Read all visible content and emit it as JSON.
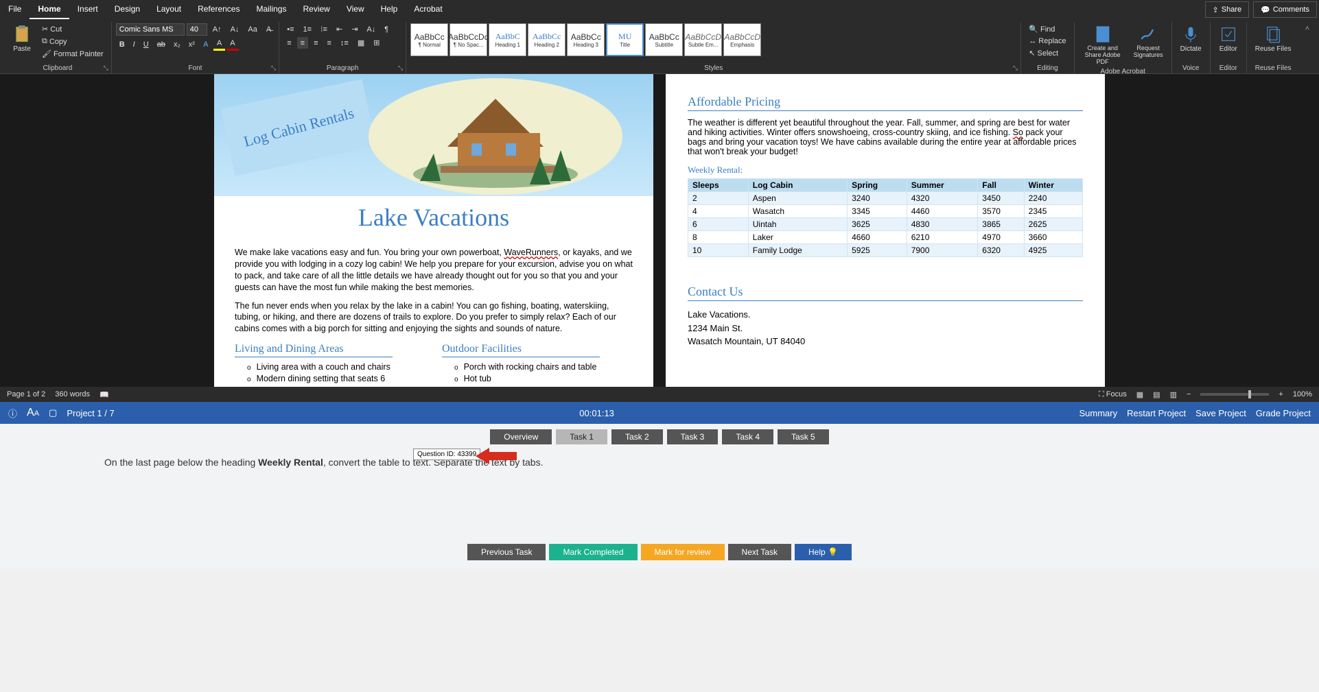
{
  "menu": [
    "File",
    "Home",
    "Insert",
    "Design",
    "Layout",
    "References",
    "Mailings",
    "Review",
    "View",
    "Help",
    "Acrobat"
  ],
  "active_menu": "Home",
  "title_right": {
    "share": "Share",
    "comments": "Comments"
  },
  "ribbon": {
    "clipboard": {
      "paste": "Paste",
      "cut": "Cut",
      "copy": "Copy",
      "format_painter": "Format Painter",
      "label": "Clipboard"
    },
    "font": {
      "name": "Comic Sans MS",
      "size": "40",
      "bold": "B",
      "italic": "I",
      "underline": "U",
      "strike": "ab",
      "sub": "x₂",
      "sup": "x²",
      "label": "Font"
    },
    "paragraph": {
      "label": "Paragraph"
    },
    "styles": {
      "label": "Styles",
      "items": [
        {
          "sample": "AaBbCc",
          "name": "¶ Normal"
        },
        {
          "sample": "AaBbCcDd",
          "name": "¶ No Spac..."
        },
        {
          "sample": "AaBbC",
          "name": "Heading 1",
          "blue": true
        },
        {
          "sample": "AaBbCc",
          "name": "Heading 2",
          "blue": true
        },
        {
          "sample": "AaBbCc",
          "name": "Heading 3"
        },
        {
          "sample": "MU",
          "name": "Title",
          "blue": true,
          "selected": true
        },
        {
          "sample": "AaBbCc",
          "name": "Subtitle"
        },
        {
          "sample": "AaBbCcD",
          "name": "Subtle Em...",
          "it": true
        },
        {
          "sample": "AaBbCcD",
          "name": "Emphasis",
          "it": true
        }
      ]
    },
    "editing": {
      "find": "Find",
      "replace": "Replace",
      "select": "Select",
      "label": "Editing"
    },
    "adobe": {
      "share": "Create and Share Adobe PDF",
      "sign": "Request Signatures",
      "label": "Adobe Acrobat"
    },
    "voice": {
      "dictate": "Dictate",
      "label": "Voice"
    },
    "editor": {
      "editor": "Editor",
      "label": "Editor"
    },
    "reuse": {
      "reuse": "Reuse Files",
      "label": "Reuse Files"
    }
  },
  "doc": {
    "banner": "Log Cabin Rentals",
    "title": "Lake Vacations",
    "para1a": "We make lake vacations easy and fun. You bring your own powerboat, ",
    "para1_wave": "WaveRunners",
    "para1b": ", or kayaks, and we provide you with lodging in a cozy log cabin! We help you prepare for your excursion, advise you on what to pack, and take care of all the little details we have already thought out for you so that you and your guests can have the most fun while making the best memories.",
    "para2": "The fun never ends when you relax by the lake in a cabin! You can go fishing, boating, waterskiing, tubing, or hiking, and there are dozens of trails to explore. Do you prefer to simply relax? Each of our cabins comes with a big porch for sitting and enjoying the sights and sounds of nature.",
    "h_living": "Living and Dining Areas",
    "h_outdoor": "Outdoor Facilities",
    "living_items": [
      "Living area with a couch and chairs",
      "Modern dining setting that seats 6"
    ],
    "outdoor_items": [
      "Porch with rocking chairs and table",
      "Hot tub"
    ],
    "h_pricing": "Affordable Pricing",
    "pricing_para_a": "The weather is different yet beautiful throughout the year. Fall, summer, and spring are best for water and hiking activities. Winter offers snowshoeing, cross-country skiing, and ice fishing. ",
    "pricing_so": "So",
    "pricing_para_b": " pack your bags and bring your vacation toys! We have cabins available during the entire year at affordable prices that won't break your budget!",
    "weekly": "Weekly Rental:",
    "table_headers": [
      "Sleeps",
      "Log Cabin",
      "Spring",
      "Summer",
      "Fall",
      "Winter"
    ],
    "table_rows": [
      [
        "2",
        "Aspen",
        "3240",
        "4320",
        "3450",
        "2240"
      ],
      [
        "4",
        "Wasatch",
        "3345",
        "4460",
        "3570",
        "2345"
      ],
      [
        "6",
        "Uintah",
        "3625",
        "4830",
        "3865",
        "2625"
      ],
      [
        "8",
        "Laker",
        "4660",
        "6210",
        "4970",
        "3660"
      ],
      [
        "10",
        "Family Lodge",
        "5925",
        "7900",
        "6320",
        "4925"
      ]
    ],
    "h_contact": "Contact Us",
    "contact": [
      "Lake Vacations.",
      "1234 Main St.",
      "Wasatch Mountain, UT 84040"
    ]
  },
  "status": {
    "page": "Page 1 of 2",
    "words": "360 words",
    "focus": "Focus",
    "zoom": "100%"
  },
  "taskbar": {
    "project": "Project 1 / 7",
    "time": "00:01:13",
    "summary": "Summary",
    "restart": "Restart Project",
    "save": "Save Project",
    "grade": "Grade Project"
  },
  "tabs": [
    "Overview",
    "Task 1",
    "Task 2",
    "Task 3",
    "Task 4",
    "Task 5"
  ],
  "active_tab": "Task 1",
  "instruction_a": "On the last page below the heading ",
  "instruction_b": "Weekly Rental",
  "instruction_c": ", convert the table to text. Separate the text by tabs.",
  "tooltip": "Question ID: 43399",
  "bottom": {
    "prev": "Previous Task",
    "complete": "Mark Completed",
    "review": "Mark for review",
    "next": "Next Task",
    "help": "Help"
  }
}
